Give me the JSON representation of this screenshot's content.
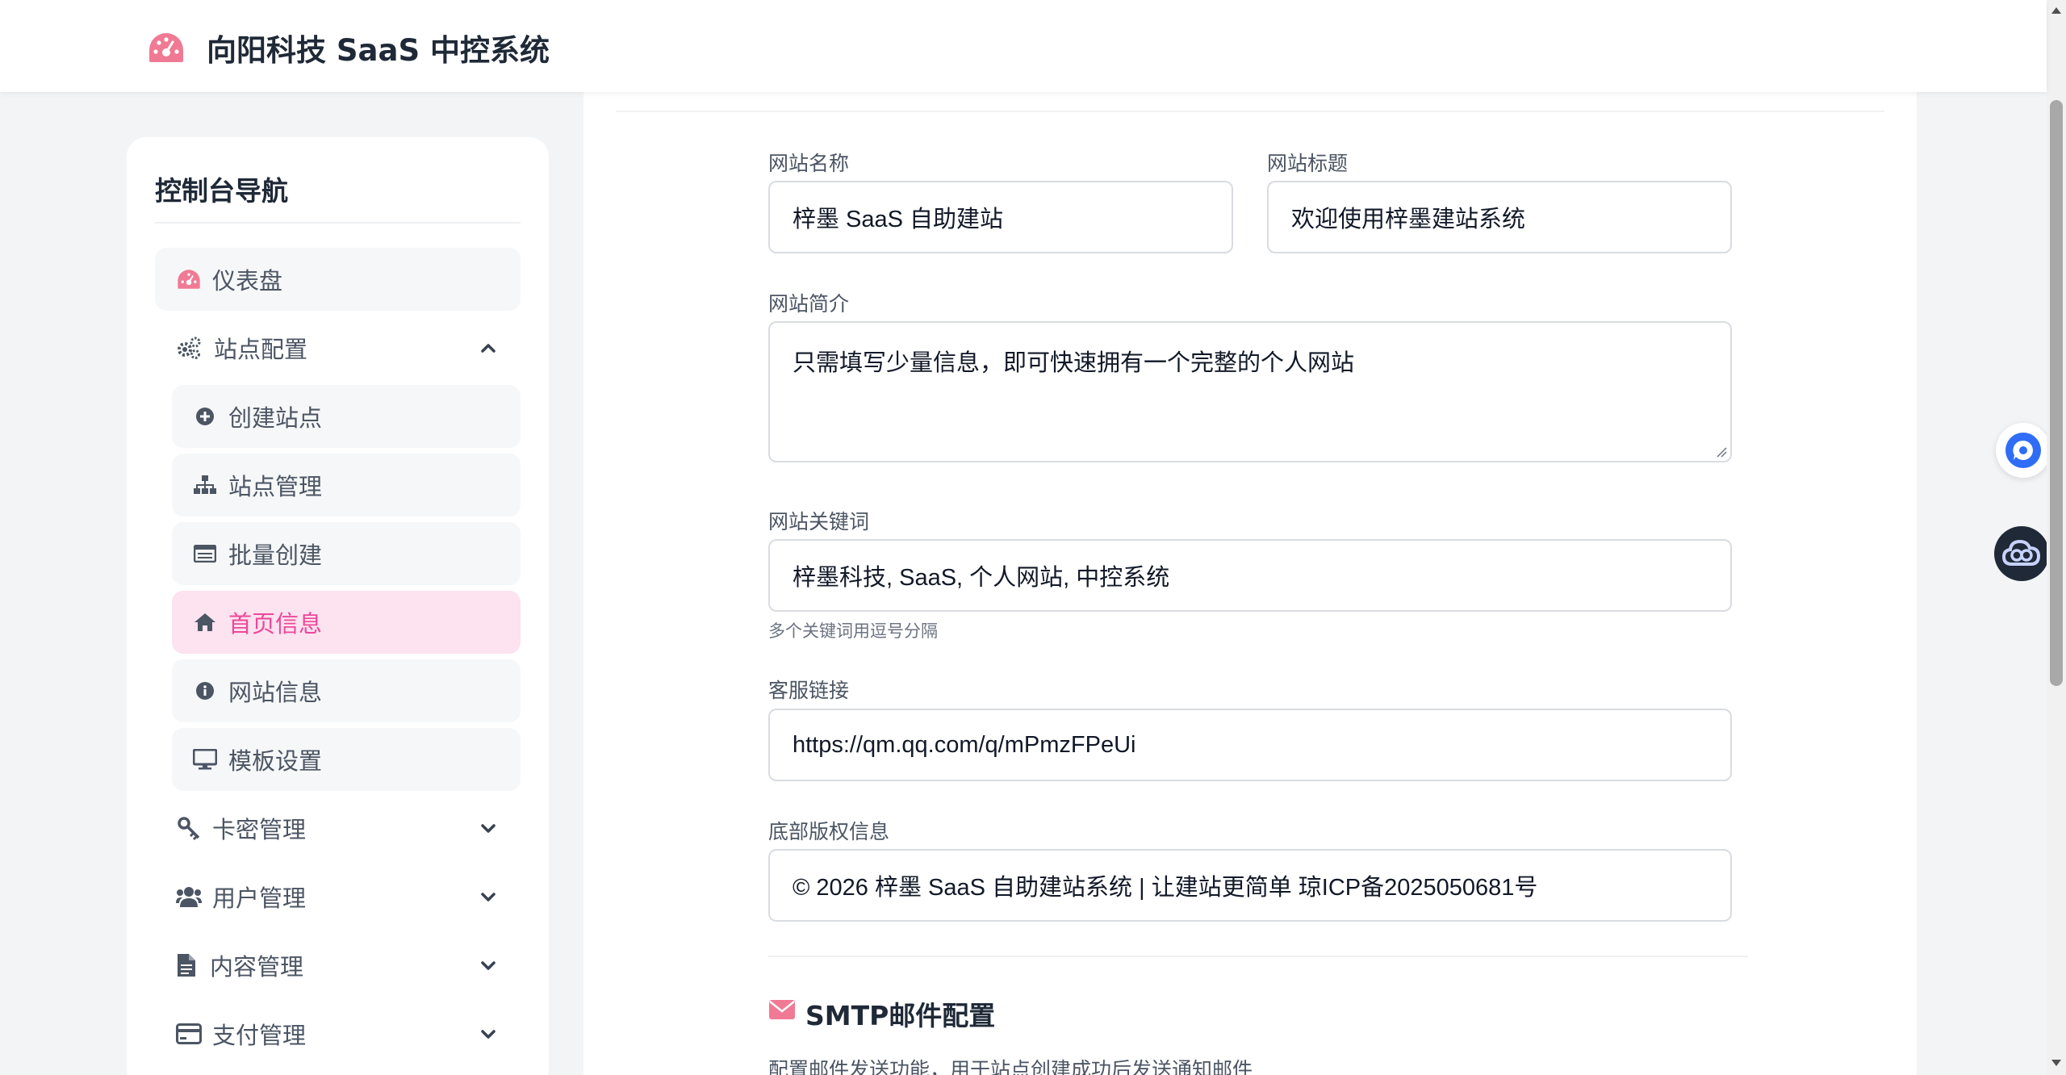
{
  "app": {
    "title": "向阳科技 SaaS 中控系统",
    "accent": "#ec4899",
    "brand_icon": "dashboard-gauge-icon"
  },
  "sidebar": {
    "title": "控制台导航",
    "items": [
      {
        "label": "仪表盘",
        "icon": "dashboard-gauge-icon"
      },
      {
        "label": "站点配置",
        "icon": "cogs-icon",
        "expanded": true
      },
      {
        "label": "创建站点",
        "icon": "plus-circle-icon"
      },
      {
        "label": "站点管理",
        "icon": "sitemap-icon"
      },
      {
        "label": "批量创建",
        "icon": "list-card-icon"
      },
      {
        "label": "首页信息",
        "icon": "home-icon",
        "active": true
      },
      {
        "label": "网站信息",
        "icon": "info-circle-icon"
      },
      {
        "label": "模板设置",
        "icon": "monitor-icon"
      },
      {
        "label": "卡密管理",
        "icon": "key-icon"
      },
      {
        "label": "用户管理",
        "icon": "users-icon"
      },
      {
        "label": "内容管理",
        "icon": "file-icon"
      },
      {
        "label": "支付管理",
        "icon": "credit-card-icon"
      }
    ]
  },
  "form": {
    "site_name": {
      "label": "网站名称",
      "value": "梓墨 SaaS 自助建站"
    },
    "site_title": {
      "label": "网站标题",
      "value": "欢迎使用梓墨建站系统"
    },
    "site_intro": {
      "label": "网站简介",
      "value": "只需填写少量信息，即可快速拥有一个完整的个人网站"
    },
    "site_keywords": {
      "label": "网站关键词",
      "value": "梓墨科技, SaaS, 个人网站, 中控系统",
      "hint": "多个关键词用逗号分隔"
    },
    "service_link": {
      "label": "客服链接",
      "value": "https://qm.qq.com/q/mPmzFPeUi"
    },
    "copyright": {
      "label": "底部版权信息",
      "value": "© 2026 梓墨 SaaS 自助建站系统 | 让建站更简单 琼ICP备2025050681号"
    }
  },
  "smtp": {
    "title": "SMTP邮件配置",
    "description": "配置邮件发送功能，用于站点创建成功后发送通知邮件",
    "icon": "envelope-icon"
  },
  "floating": {
    "btn1_icon": "chat-bubble-icon",
    "btn2_icon": "cloud-link-icon"
  }
}
